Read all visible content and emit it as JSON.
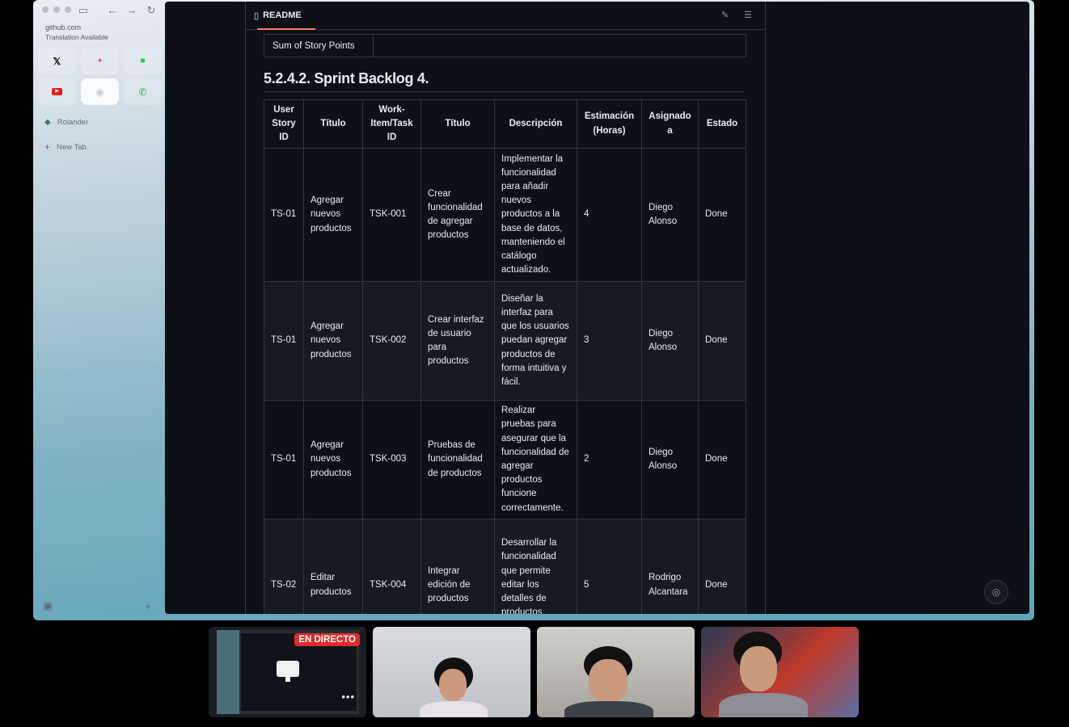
{
  "browser": {
    "url": "github.com",
    "notice": "Translation Available",
    "favorites": [
      {
        "icon": "x-icon",
        "glyph": "𝕏"
      },
      {
        "icon": "google-icon",
        "glyph": "✦"
      },
      {
        "icon": "green-app-icon",
        "glyph": "■"
      },
      {
        "icon": "youtube-icon",
        "glyph": "▶"
      },
      {
        "icon": "github-icon",
        "glyph": "◉"
      },
      {
        "icon": "whatsapp-icon",
        "glyph": "✆"
      }
    ],
    "tabs": [
      {
        "label": "Roiander"
      }
    ],
    "new_tab_label": "New Tab"
  },
  "readme": {
    "tab_label": "README",
    "prev_row_label": "Sum of Story Points",
    "heading": "5.2.4.2. Sprint Backlog 4.",
    "columns": [
      "User Story ID",
      "Título",
      "Work-Item/Task ID",
      "Título",
      "Descripción",
      "Estimación (Horas)",
      "Asignado a",
      "Estado"
    ],
    "rows": [
      {
        "story_id": "TS-01",
        "story_title": "Agregar nuevos productos",
        "task_id": "TSK-001",
        "task_title": "Crear funcionalidad de agregar productos",
        "description": "Implementar la funcionalidad para añadir nuevos productos a la base de datos, manteniendo el catálogo actualizado.",
        "estimate": "4",
        "assignee": "Diego Alonso",
        "status": "Done"
      },
      {
        "story_id": "TS-01",
        "story_title": "Agregar nuevos productos",
        "task_id": "TSK-002",
        "task_title": "Crear interfaz de usuario para productos",
        "description": "Diseñar la interfaz para que los usuarios puedan agregar productos de forma intuitiva y fácil.",
        "estimate": "3",
        "assignee": "Diego Alonso",
        "status": "Done"
      },
      {
        "story_id": "TS-01",
        "story_title": "Agregar nuevos productos",
        "task_id": "TSK-003",
        "task_title": "Pruebas de funcionalidad de productos",
        "description": "Realizar pruebas para asegurar que la funcionalidad de agregar productos funcione correctamente.",
        "estimate": "2",
        "assignee": "Diego Alonso",
        "status": "Done"
      },
      {
        "story_id": "TS-02",
        "story_title": "Editar productos",
        "task_id": "TSK-004",
        "task_title": "Integrar edición de productos",
        "description": "Desarrollar la funcionalidad que permite editar los detalles de productos existentes.",
        "estimate": "5",
        "assignee": "Rodrigo Alcantara",
        "status": "Done"
      }
    ]
  },
  "meeting": {
    "live_badge": "EN DIRECTO",
    "more_label": "•••"
  }
}
